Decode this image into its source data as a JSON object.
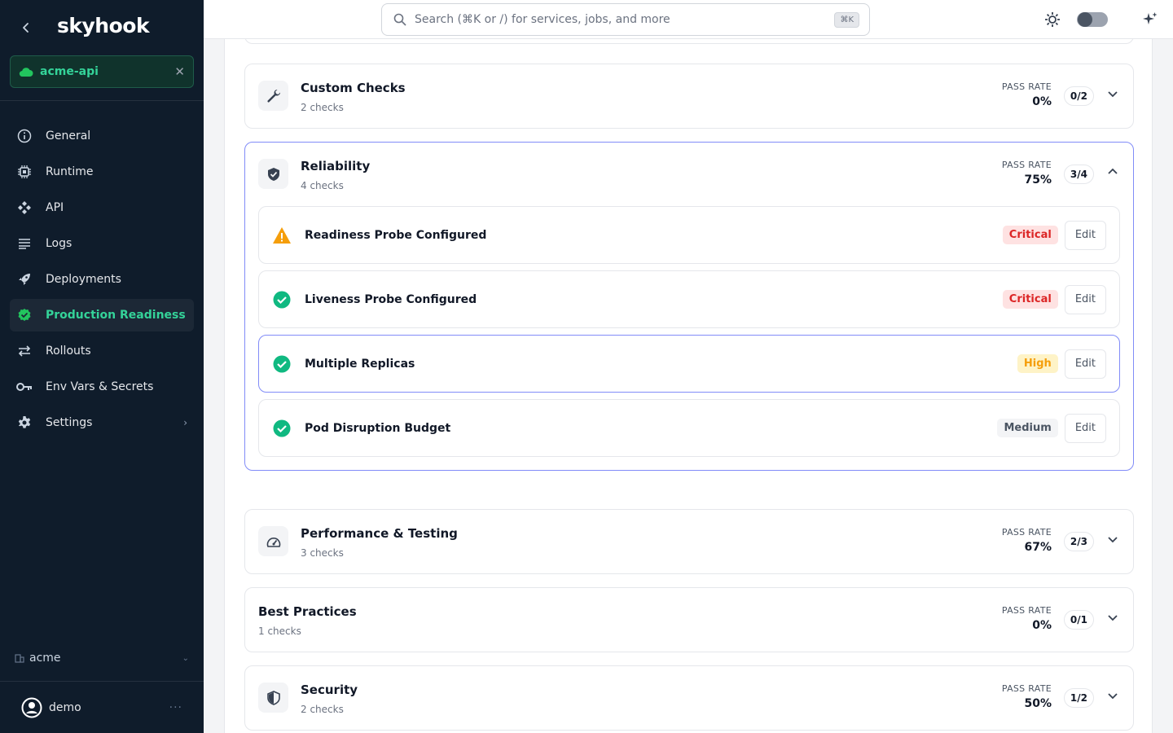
{
  "app": {
    "logo": "skyhook",
    "service": "acme-api"
  },
  "nav": [
    {
      "label": "General",
      "icon": "info-circle-icon"
    },
    {
      "label": "Runtime",
      "icon": "chip-icon"
    },
    {
      "label": "API",
      "icon": "api-icon"
    },
    {
      "label": "Logs",
      "icon": "list-icon"
    },
    {
      "label": "Deployments",
      "icon": "rocket-icon"
    },
    {
      "label": "Production Readiness",
      "icon": "shield-check-icon",
      "active": true
    },
    {
      "label": "Rollouts",
      "icon": "arrows-icon"
    },
    {
      "label": "Env Vars & Secrets",
      "icon": "key-icon"
    },
    {
      "label": "Settings",
      "icon": "gear-icon"
    }
  ],
  "org": "acme",
  "user": {
    "name": "demo"
  },
  "header": {
    "search_placeholder": "Search (⌘K or /) for services, jobs, and more",
    "shortcut": "⌘K"
  },
  "colors": {
    "sidebar_bg": "#0f1c2b",
    "accent_green": "#22c55e",
    "accent_indigo": "#818cf8",
    "critical": "#dc2626",
    "high": "#f59e0b"
  },
  "pass_rate_label": "PASS RATE",
  "edit_label": "Edit",
  "categories": [
    {
      "title": "Custom Checks",
      "subtitle": "2 checks",
      "pass_rate": "0%",
      "ratio": "0/2",
      "icon": "wrench-icon",
      "expanded": false
    },
    {
      "title": "Reliability",
      "subtitle": "4 checks",
      "pass_rate": "75%",
      "ratio": "3/4",
      "icon": "shield-icon",
      "expanded": true,
      "checks": [
        {
          "name": "Readiness Probe Configured",
          "status": "warning",
          "severity": "Critical"
        },
        {
          "name": "Liveness Probe Configured",
          "status": "passed",
          "severity": "Critical"
        },
        {
          "name": "Multiple Replicas",
          "status": "passed",
          "severity": "High",
          "selected": true
        },
        {
          "name": "Pod Disruption Budget",
          "status": "passed",
          "severity": "Medium"
        }
      ]
    },
    {
      "title": "Performance & Testing",
      "subtitle": "3 checks",
      "pass_rate": "67%",
      "ratio": "2/3",
      "icon": "gauge-icon",
      "expanded": false
    },
    {
      "title": "Best Practices",
      "subtitle": "1 checks",
      "pass_rate": "0%",
      "ratio": "0/1",
      "icon": "",
      "expanded": false
    },
    {
      "title": "Security",
      "subtitle": "2 checks",
      "pass_rate": "50%",
      "ratio": "1/2",
      "icon": "shield-half-icon",
      "expanded": false
    }
  ]
}
